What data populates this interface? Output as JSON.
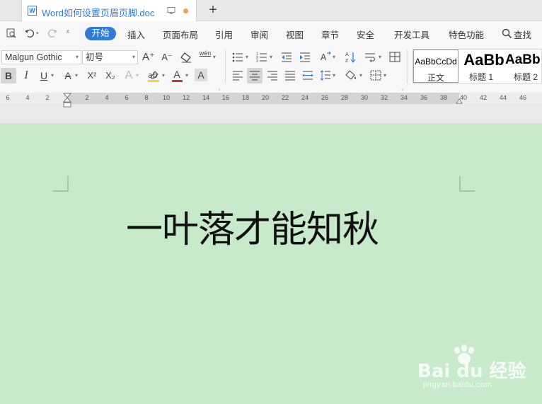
{
  "tab": {
    "title": "Word如何设置页眉页脚.doc",
    "new_tab": "+"
  },
  "menu": [
    {
      "label": "开始",
      "active": true
    },
    {
      "label": "插入"
    },
    {
      "label": "页面布局"
    },
    {
      "label": "引用"
    },
    {
      "label": "审阅"
    },
    {
      "label": "视图"
    },
    {
      "label": "章节"
    },
    {
      "label": "安全"
    },
    {
      "label": "开发工具"
    },
    {
      "label": "特色功能"
    },
    {
      "label": "查找"
    }
  ],
  "font": {
    "family": "Malgun Gothic",
    "size": "初号"
  },
  "format_buttons": {
    "bold": "B",
    "italic": "I",
    "underline": "U",
    "strike": "A",
    "superscript": "X²",
    "subscript": "X₂",
    "outline": "A",
    "font_color": "A",
    "char_shade": "A",
    "grow": "A⁺",
    "shrink": "A⁻",
    "phonetic": "wén"
  },
  "styles": [
    {
      "sample": "AaBbCcDd",
      "name": "正文"
    },
    {
      "sample": "AaBb",
      "name": "标题 1"
    },
    {
      "sample": "AaBb",
      "name": "标题 2"
    }
  ],
  "ruler": {
    "ticks": [
      "6",
      "4",
      "2",
      "",
      "2",
      "4",
      "6",
      "8",
      "10",
      "12",
      "14",
      "16",
      "18",
      "20",
      "22",
      "24",
      "26",
      "28",
      "30",
      "32",
      "34",
      "36",
      "38",
      "40",
      "42",
      "44",
      "46"
    ]
  },
  "document": {
    "body_text": "一叶落才能知秋"
  },
  "watermark": {
    "main": "Bai du 经验",
    "sub": "jingyan.baidu.com"
  },
  "colors": {
    "accent": "#2f7bd6",
    "page_bg": "#c8eacb",
    "unsaved_dot": "#f2a04c"
  }
}
